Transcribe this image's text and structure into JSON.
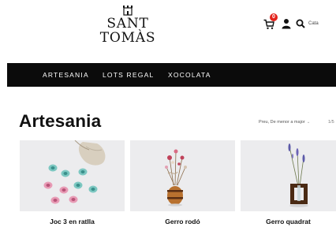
{
  "header": {
    "brand": "SANT TOMÀS",
    "cart_count": "0",
    "lang_label": "Cata"
  },
  "nav": {
    "items": [
      "ARTESANIA",
      "LOTS REGAL",
      "XOCOLATA"
    ]
  },
  "category": {
    "title": "Artesania",
    "sort_label": "Preu, De menor a major",
    "pager": "1/5"
  },
  "products": [
    {
      "name": "Joc 3 en ratlla",
      "image": "tic-tac-toe-pebbles"
    },
    {
      "name": "Gerro rodó",
      "image": "round-vase-dried-flowers"
    },
    {
      "name": "Gerro quadrat",
      "image": "square-vase-lavender"
    }
  ],
  "colors": {
    "navbar": "#0b0b0b",
    "badge": "#e3231c",
    "image_bg": "#ededed"
  },
  "icons": [
    "castle-logo-icon",
    "cart-icon",
    "user-icon",
    "search-icon",
    "chevron-down-icon"
  ]
}
